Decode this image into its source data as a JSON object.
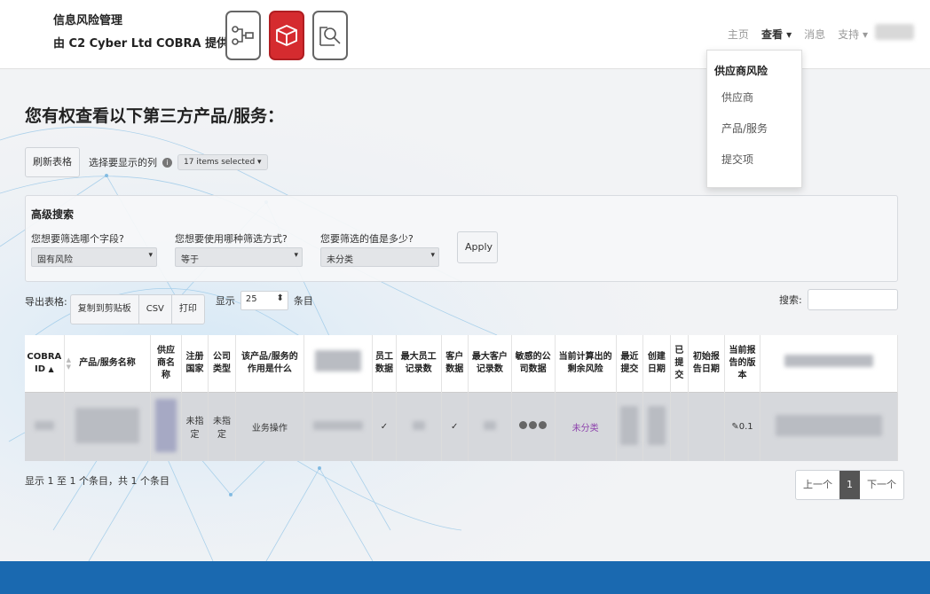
{
  "brand": {
    "line1": "信息风险管理",
    "line2": "由 C2 Cyber Ltd COBRA 提供支持"
  },
  "app_icons": [
    "workflow-icon",
    "box-icon",
    "search-doc-icon"
  ],
  "topnav": {
    "home": "主页",
    "view": "查看 ▾",
    "messages": "消息",
    "support": "支持 ▾"
  },
  "dropdown": {
    "header": "供应商风险",
    "items": [
      "供应商",
      "产品/服务",
      "提交项"
    ]
  },
  "page_title": "您有权查看以下第三方产品/服务：",
  "toolbar": {
    "refresh": "刷新表格",
    "columns_label": "选择要显示的列",
    "columns_selected": "17 items selected ▾"
  },
  "advanced": {
    "title": "高级搜索",
    "q1": "您想要筛选哪个字段?",
    "q1_value": "固有风险",
    "q2": "您想要使用哪种筛选方式?",
    "q2_value": "等于",
    "q3": "您要筛选的值是多少?",
    "q3_value": "未分类",
    "apply": "Apply"
  },
  "export": {
    "label": "导出表格:",
    "copy": "复制到剪贴板",
    "csv": "CSV",
    "print": "打印",
    "show": "显示",
    "length": "25",
    "entries": "条目"
  },
  "search": {
    "label": "搜索:"
  },
  "table": {
    "headers": [
      "COBRA ID",
      "产品/服务名称",
      "供应商名称",
      "注册国家",
      "公司类型",
      "该产品/服务的作用是什么",
      "",
      "员工数据",
      "最大员工记录数",
      "客户数据",
      "最大客户记录数",
      "敏感的公司数据",
      "当前计算出的剩余风险",
      "最近提交",
      "创建日期",
      "已提交",
      "初始报告日期",
      "当前报告的版本",
      ""
    ],
    "row": {
      "country": "未指定",
      "company_type": "未指定",
      "role": "业务操作",
      "employee_data": "✓",
      "customer_data": "✓",
      "residual_risk": "未分类",
      "report_version": "0.1"
    }
  },
  "footer": {
    "info": "显示 1 至 1 个条目，共 1 个条目",
    "prev": "上一个",
    "page": "1",
    "next": "下一个"
  }
}
